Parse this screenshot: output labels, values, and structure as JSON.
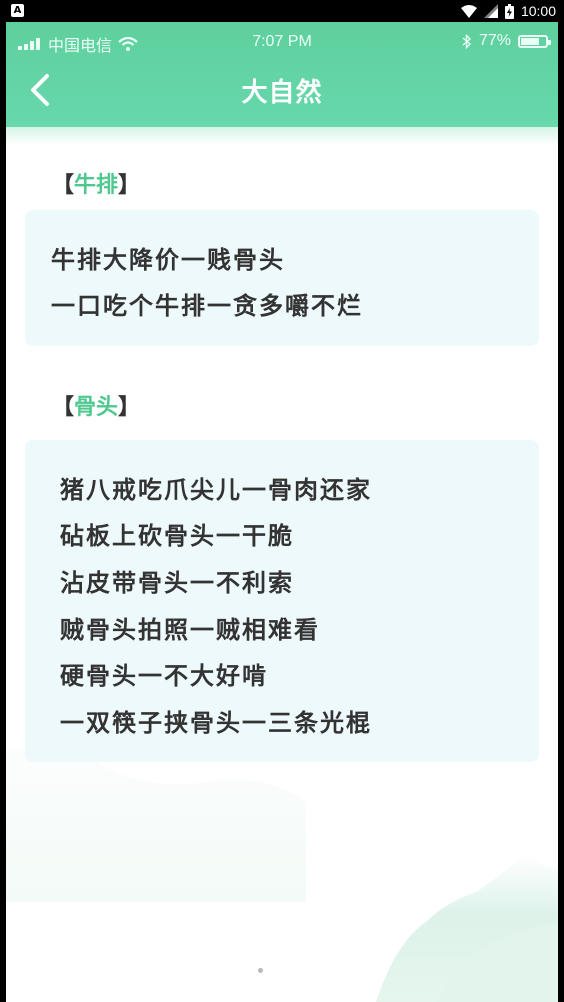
{
  "system_bar": {
    "time": "10:00",
    "badge": "A"
  },
  "status_bar": {
    "carrier": "中国电信",
    "time": "7:07 PM",
    "battery": "77%",
    "battery_level": 0.77
  },
  "header": {
    "title": "大自然"
  },
  "sections": [
    {
      "title_open": "【",
      "title": "牛排",
      "title_close": "】",
      "lines": [
        "牛排大降价一贱骨头",
        "一口吃个牛排一贪多嚼不烂"
      ]
    },
    {
      "title_open": "【",
      "title": "骨头",
      "title_close": "】",
      "lines": [
        "猪八戒吃爪尖儿一骨肉还家",
        "砧板上砍骨头一干脆",
        "沾皮带骨头一不利索",
        "贼骨头拍照一贼相难看",
        "硬骨头一不大好啃",
        "一双筷子挟骨头一三条光棍"
      ]
    }
  ],
  "colors": {
    "header": "#5fcf9d",
    "accent": "#4fc88f",
    "card": "#eef9fb",
    "text": "#333333"
  }
}
